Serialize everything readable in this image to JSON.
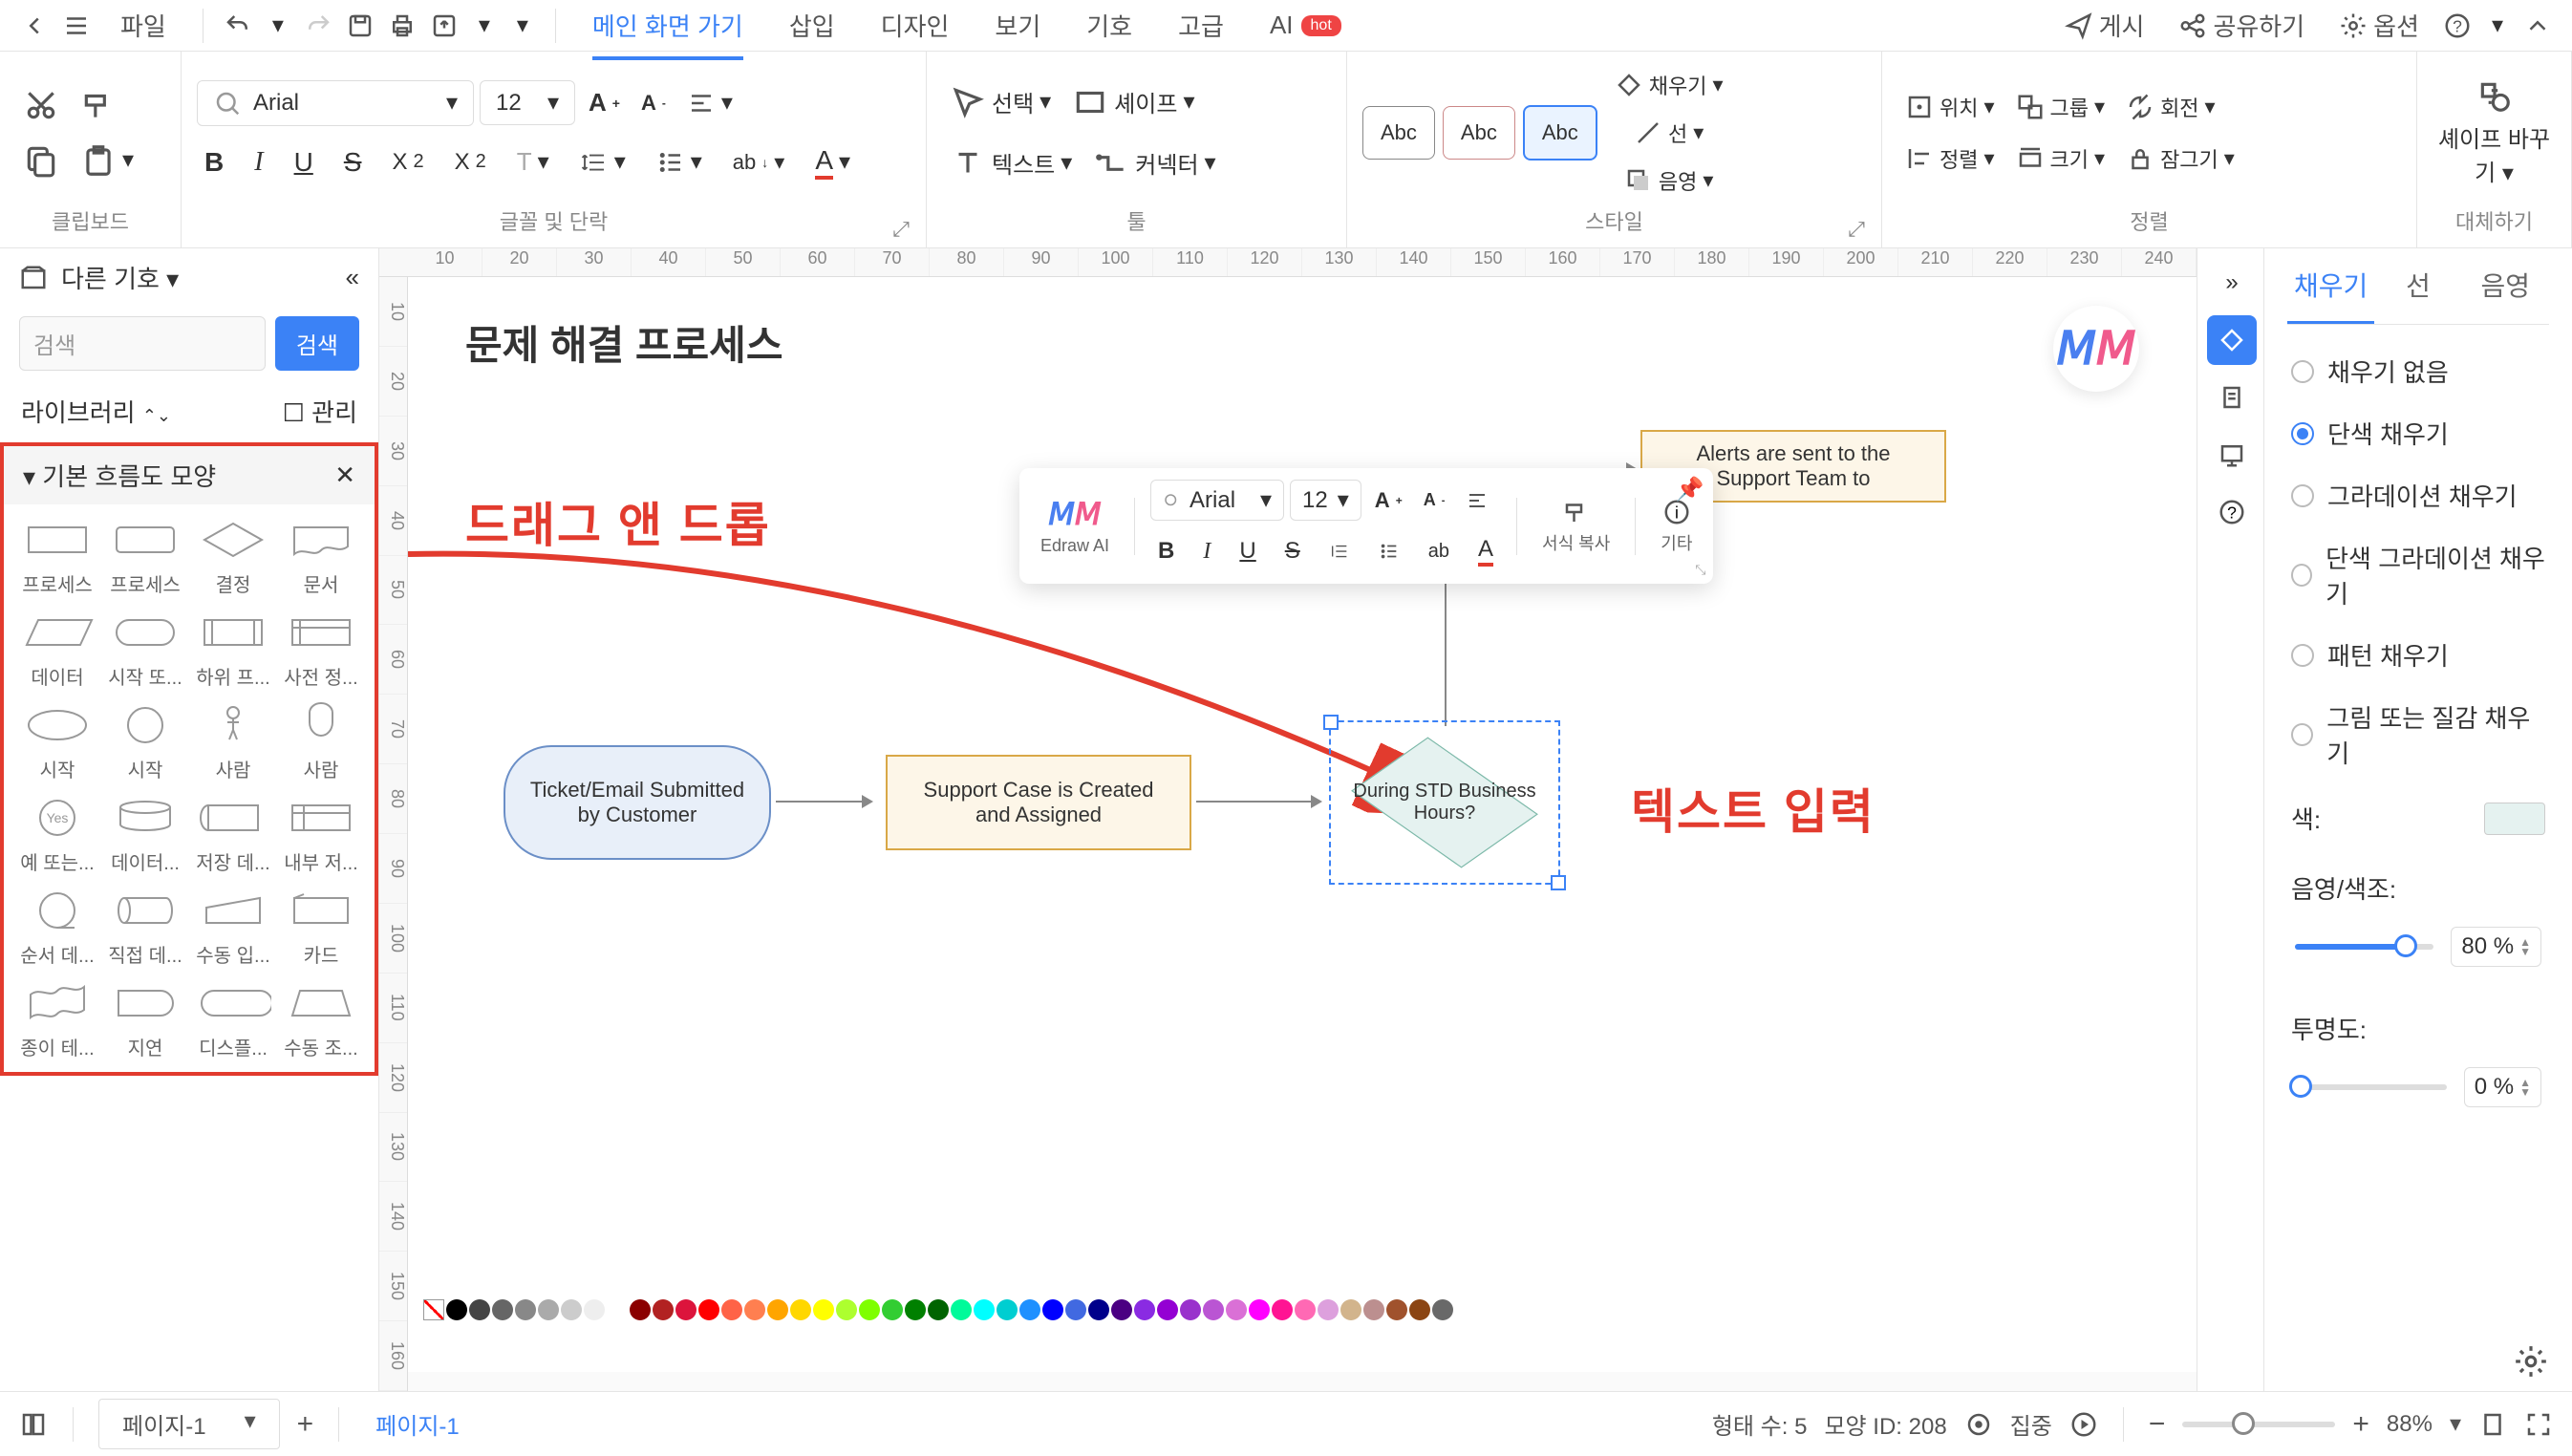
{
  "topbar": {
    "file_label": "파일",
    "menu": [
      "메인 화면 가기",
      "삽입",
      "디자인",
      "보기",
      "기호",
      "고급"
    ],
    "ai": "AI",
    "hot": "hot",
    "publish": "게시",
    "share": "공유하기",
    "options": "옵션"
  },
  "ribbon": {
    "clipboard": {
      "label": "클립보드"
    },
    "font": {
      "label": "글꼴 및 단락",
      "name": "Arial",
      "size": "12"
    },
    "tool": {
      "label": "툴",
      "select": "선택",
      "shape": "셰이프",
      "text": "텍스트",
      "connector": "커넥터"
    },
    "style": {
      "label": "스타일",
      "swatches": [
        "Abc",
        "Abc",
        "Abc"
      ],
      "fill": "채우기",
      "line": "선",
      "shadow": "음영"
    },
    "align": {
      "label": "정렬",
      "position": "위치",
      "align_btn": "정렬",
      "group": "그룹",
      "size": "크기",
      "rotate": "회전",
      "lock": "잠그기"
    },
    "replace": {
      "label": "대체하기",
      "shape_replace": "셰이프 바꾸기"
    }
  },
  "left": {
    "other_symbols": "다른 기호",
    "search_placeholder": "검색",
    "search_btn": "검색",
    "library": "라이브러리",
    "manage": "관리",
    "category": "기본 흐름도 모양",
    "shapes": [
      "프로세스",
      "프로세스",
      "결정",
      "문서",
      "데이터",
      "시작 또...",
      "하위 프...",
      "사전 정...",
      "시작",
      "시작",
      "사람",
      "사람",
      "예 또는...",
      "데이터...",
      "저장 데...",
      "내부 저...",
      "순서 데...",
      "직접 데...",
      "수동 입...",
      "카드",
      "종이 테...",
      "지연",
      "디스플...",
      "수동 조..."
    ]
  },
  "canvas": {
    "title": "문제 해결 프로세스",
    "hruler": [
      "10",
      "20",
      "30",
      "40",
      "50",
      "60",
      "70",
      "80",
      "90",
      "100",
      "110",
      "120",
      "130",
      "140",
      "150",
      "160",
      "170",
      "180",
      "190",
      "200",
      "210",
      "220",
      "230",
      "240"
    ],
    "vruler": [
      "10",
      "20",
      "30",
      "40",
      "50",
      "60",
      "70",
      "80",
      "90",
      "100",
      "110",
      "120",
      "130",
      "140",
      "150",
      "160"
    ],
    "annot_drag": "드래그 앤 드롭",
    "annot_text": "텍스트 입력",
    "node1": "Ticket/Email Submitted by Customer",
    "node2": "Support Case is Created and Assigned",
    "node3": "During STD Business Hours?",
    "node4": "Alerts are sent to the Support Team to"
  },
  "float_tb": {
    "edraw_ai": "Edraw AI",
    "font": "Arial",
    "size": "12",
    "format_copy": "서식 복사",
    "other": "기타"
  },
  "right": {
    "tabs": [
      "채우기",
      "선",
      "음영"
    ],
    "fill_options": [
      "채우기 없음",
      "단색 채우기",
      "그라데이션 채우기",
      "단색 그라데이션 채우기",
      "패턴 채우기",
      "그림 또는 질감 채우기"
    ],
    "selected_option": 1,
    "color_label": "색:",
    "shadow_label": "음영/색조:",
    "shadow_value": "80 %",
    "opacity_label": "투명도:",
    "opacity_value": "0 %"
  },
  "status": {
    "page_select": "페이지-1",
    "page_tab": "페이지-1",
    "shapes_count_label": "형태 수:",
    "shapes_count": "5",
    "shape_id_label": "모양 ID:",
    "shape_id": "208",
    "focus": "집중",
    "zoom": "88%"
  },
  "palette_colors": [
    "#000",
    "#444",
    "#666",
    "#888",
    "#aaa",
    "#ccc",
    "#eee",
    "#fff",
    "#8b0000",
    "#b22222",
    "#dc143c",
    "#ff0000",
    "#ff6347",
    "#ff7f50",
    "#ffa500",
    "#ffd700",
    "#ffff00",
    "#adff2f",
    "#7fff00",
    "#32cd32",
    "#008000",
    "#006400",
    "#00fa9a",
    "#00ffff",
    "#00ced1",
    "#1e90ff",
    "#0000ff",
    "#4169e1",
    "#00008b",
    "#4b0082",
    "#8a2be2",
    "#9400d3",
    "#9932cc",
    "#ba55d3",
    "#da70d6",
    "#ff00ff",
    "#ff1493",
    "#ff69b4",
    "#dda0dd",
    "#d2b48c",
    "#bc8f8f",
    "#a0522d",
    "#8b4513",
    "#696969"
  ]
}
